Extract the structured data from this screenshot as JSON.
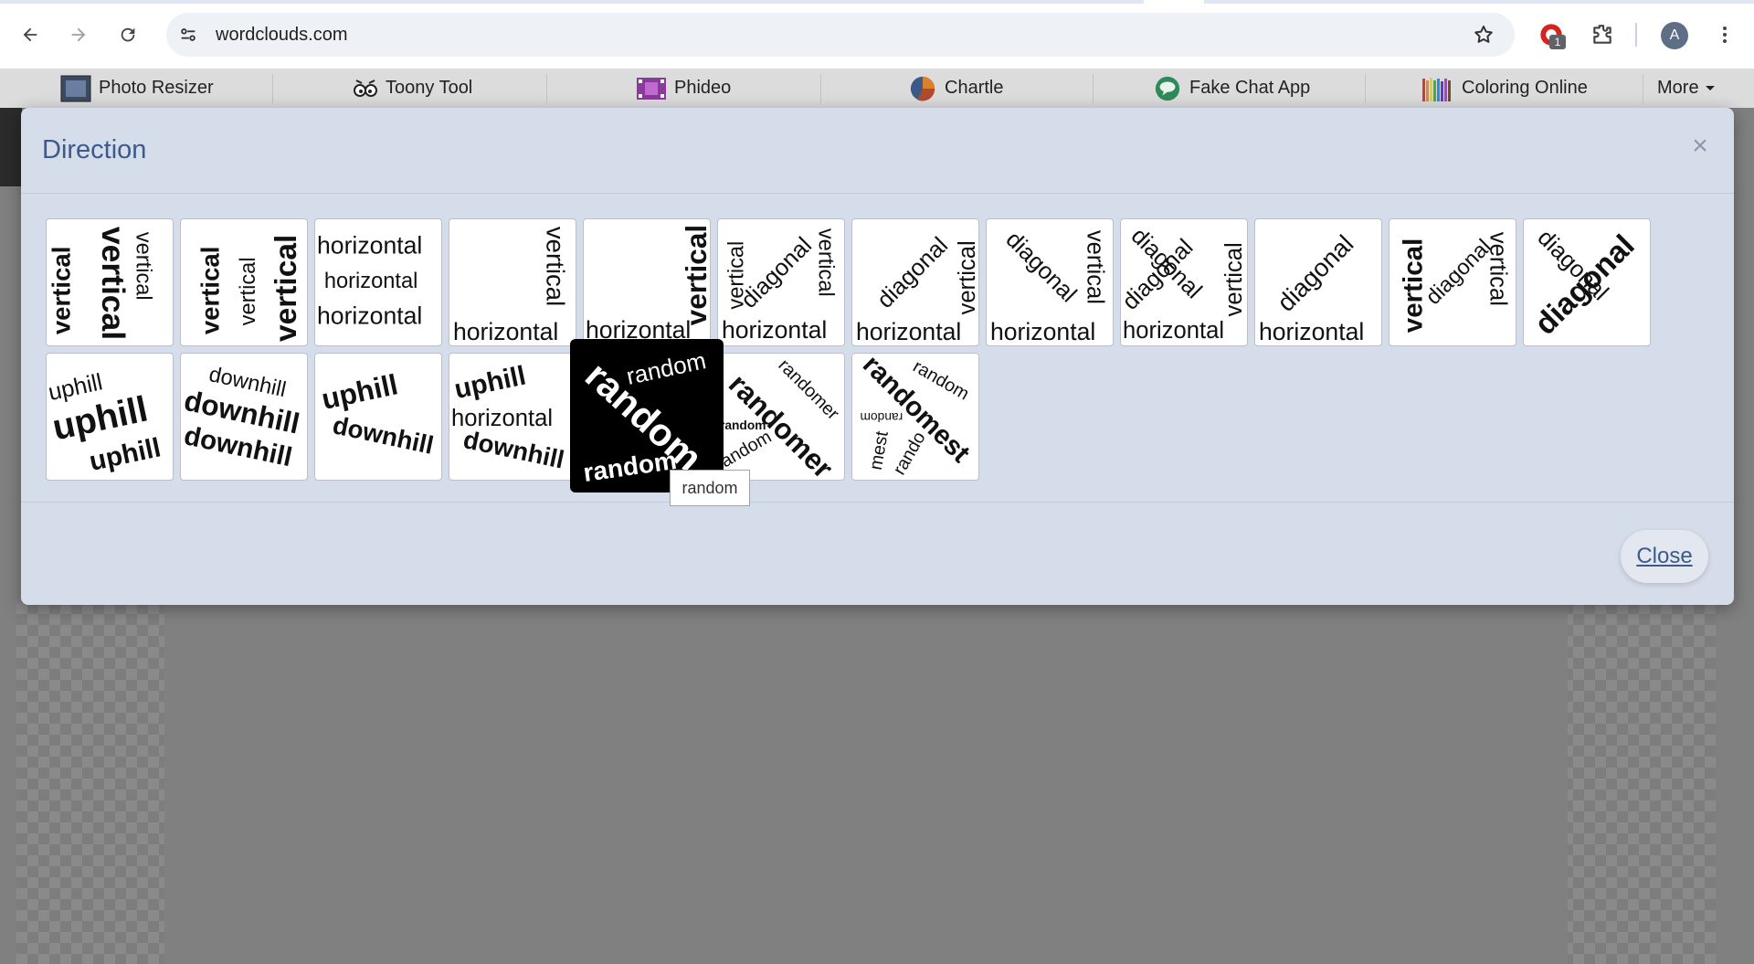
{
  "browser": {
    "url": "wordclouds.com",
    "extension_badge": "1",
    "profile_initial": "A"
  },
  "appbar": {
    "items": [
      {
        "label": "Photo Resizer",
        "icon": "photo-resizer-icon"
      },
      {
        "label": "Toony Tool",
        "icon": "toony-tool-icon"
      },
      {
        "label": "Phideo",
        "icon": "phideo-icon"
      },
      {
        "label": "Chartle",
        "icon": "chartle-icon"
      },
      {
        "label": "Fake Chat App",
        "icon": "fake-chat-app-icon"
      },
      {
        "label": "Coloring Online",
        "icon": "coloring-online-icon"
      }
    ],
    "more_label": "More"
  },
  "modal": {
    "title": "Direction",
    "close_label": "Close",
    "tooltip": "random",
    "tiles_row1": [
      {
        "name": "vertical-mixed",
        "words": [
          "vertical",
          "vertical",
          "vertical"
        ]
      },
      {
        "name": "vertical-up",
        "words": [
          "vertical",
          "vertical",
          "vertical"
        ]
      },
      {
        "name": "horizontal",
        "words": [
          "horizontal",
          "horizontal",
          "horizontal"
        ]
      },
      {
        "name": "horizontal-vertical",
        "words": [
          "vertical",
          "horizontal"
        ]
      },
      {
        "name": "horizontal-vertical-big",
        "words": [
          "vertical",
          "horizontal"
        ]
      },
      {
        "name": "vertical-diagonal-horizontal",
        "words": [
          "vertical",
          "diagonal",
          "vertical",
          "horizontal"
        ]
      },
      {
        "name": "diagonal-vertical-horizontal",
        "words": [
          "diagonal",
          "vertical",
          "horizontal"
        ]
      },
      {
        "name": "diagonal-down-vertical-horizontal",
        "words": [
          "diagonal",
          "vertical",
          "horizontal"
        ]
      },
      {
        "name": "diagonal-cross-vertical-horizontal",
        "words": [
          "diagonal",
          "diagonal",
          "vertical",
          "horizontal"
        ]
      },
      {
        "name": "diagonal-horizontal",
        "words": [
          "diagonal",
          "horizontal"
        ]
      },
      {
        "name": "vertical-diagonal",
        "words": [
          "vertical",
          "diagonal",
          "vertical"
        ]
      },
      {
        "name": "diagonal-only",
        "words": [
          "diagonal",
          "diagonal"
        ]
      }
    ],
    "tiles_row2": [
      {
        "name": "uphill",
        "words": [
          "uphill",
          "uphill",
          "uphill"
        ]
      },
      {
        "name": "downhill",
        "words": [
          "downhill",
          "downhill",
          "downhill"
        ]
      },
      {
        "name": "uphill-downhill",
        "words": [
          "uphill",
          "downhill"
        ]
      },
      {
        "name": "uphill-horizontal-downhill",
        "words": [
          "uphill",
          "horizontal",
          "downhill"
        ]
      },
      {
        "name": "random",
        "words": [
          "random",
          "random",
          "random"
        ],
        "selected": true
      },
      {
        "name": "randomer",
        "words": [
          "randomer",
          "randomer",
          "random",
          "random"
        ]
      },
      {
        "name": "randomest",
        "words": [
          "randomest",
          "random",
          "random",
          "mest",
          "rando"
        ]
      }
    ]
  }
}
